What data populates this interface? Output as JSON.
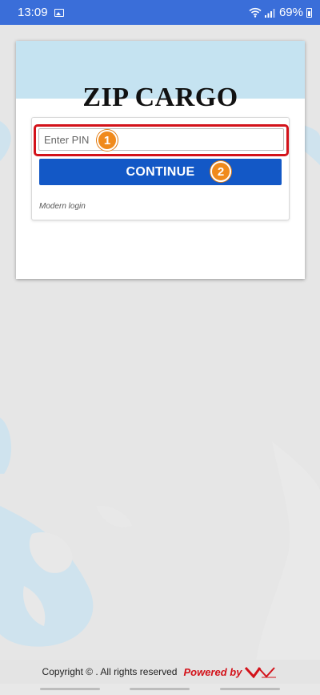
{
  "status_bar": {
    "time": "13:09",
    "battery": "69%",
    "icons": [
      "image-icon",
      "wifi-icon",
      "signal-icon",
      "battery-icon"
    ]
  },
  "card": {
    "title": "ZIP CARGO",
    "pin_placeholder": "Enter PIN",
    "pin_value": "",
    "continue_label": "CONTINUE",
    "modern_login": "Modern login",
    "step_badges": [
      "1",
      "2"
    ]
  },
  "footer": {
    "copyright": "Copyright © . All rights reserved",
    "powered": "Powered by",
    "brand_logo": "vnvn-logo"
  },
  "colors": {
    "status_bar": "#3a6ed9",
    "header": "#c5e3f1",
    "button": "#1358c6",
    "highlight": "#d3121a",
    "badge": "#f08a1c"
  }
}
